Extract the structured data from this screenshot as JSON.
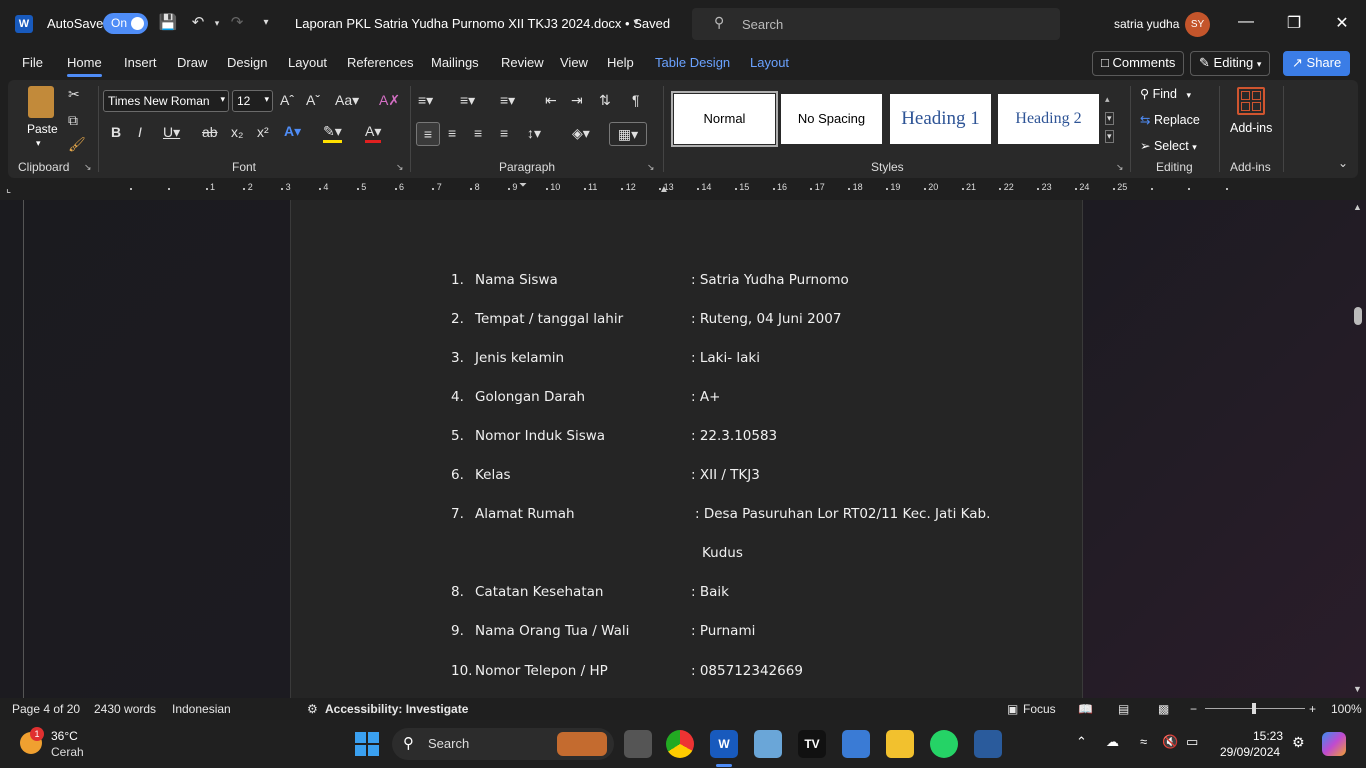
{
  "titlebar": {
    "autosave_label": "AutoSave",
    "autosave_state": "On",
    "doc_title": "Laporan PKL Satria Yudha Purnomo XII TKJ3 2024.docx • Saved",
    "search_placeholder": "Search",
    "user_name": "satria yudha",
    "user_initials": "SY"
  },
  "menu": {
    "tabs": [
      "File",
      "Home",
      "Insert",
      "Draw",
      "Design",
      "Layout",
      "References",
      "Mailings",
      "Review",
      "View",
      "Help",
      "Table Design",
      "Layout"
    ],
    "comments": "Comments",
    "editing": "Editing",
    "share": "Share"
  },
  "ribbon": {
    "paste": "Paste",
    "font_name": "Times New Roman",
    "font_size": "12",
    "styles": [
      "Normal",
      "No Spacing",
      "Heading 1",
      "Heading 2"
    ],
    "find": "Find",
    "replace": "Replace",
    "select": "Select",
    "addins": "Add-ins",
    "groups": {
      "clipboard": "Clipboard",
      "font": "Font",
      "paragraph": "Paragraph",
      "styles": "Styles",
      "editing": "Editing",
      "addins": "Add-ins"
    }
  },
  "ruler": {
    "numbers": [
      "1",
      "2",
      "3",
      "4",
      "5",
      "6",
      "7",
      "8",
      "9",
      "10",
      "11",
      "12",
      "13",
      "14",
      "15",
      "16",
      "17",
      "18",
      "19",
      "20",
      "21",
      "22",
      "23",
      "24",
      "25"
    ]
  },
  "document": {
    "items": [
      {
        "num": "1.",
        "label": "Nama Siswa",
        "value": ":  Satria Yudha Purnomo"
      },
      {
        "num": "2.",
        "label": "Tempat / tanggal lahir",
        "value": ": Ruteng, 04 Juni 2007"
      },
      {
        "num": "3.",
        "label": "Jenis kelamin",
        "value": ":  Laki- laki"
      },
      {
        "num": "4.",
        "label": "Golongan Darah",
        "value": ": A+"
      },
      {
        "num": "5.",
        "label": "Nomor Induk Siswa",
        "value": ": 22.3.10583"
      },
      {
        "num": "6.",
        "label": "Kelas",
        "value": ": XII / TKJ3"
      },
      {
        "num": "7.",
        "label": "Alamat Rumah",
        "value": ": Desa Pasuruhan Lor RT02/11 Kec. Jati Kab."
      },
      {
        "num": "",
        "label": "",
        "value": "Kudus"
      },
      {
        "num": "8.",
        "label": "Catatan Kesehatan",
        "value": ": Baik"
      },
      {
        "num": "9.",
        "label": "Nama Orang Tua / Wali",
        "value": ": Purnami"
      },
      {
        "num": "10.",
        "label": "Nomor Telepon / HP",
        "value": ": 085712342669"
      }
    ]
  },
  "statusbar": {
    "page": "Page 4 of 20",
    "words": "2430 words",
    "language": "Indonesian",
    "accessibility": "Accessibility: Investigate",
    "focus": "Focus",
    "zoom": "100%"
  },
  "taskbar": {
    "weather_temp": "36°C",
    "weather_desc": "Cerah",
    "weather_badge": "1",
    "search": "Search",
    "time": "15:23",
    "date": "29/09/2024"
  },
  "colors": {
    "accent": "#4f8df7",
    "word_blue": "#185abd",
    "avatar": "#c4552b"
  }
}
